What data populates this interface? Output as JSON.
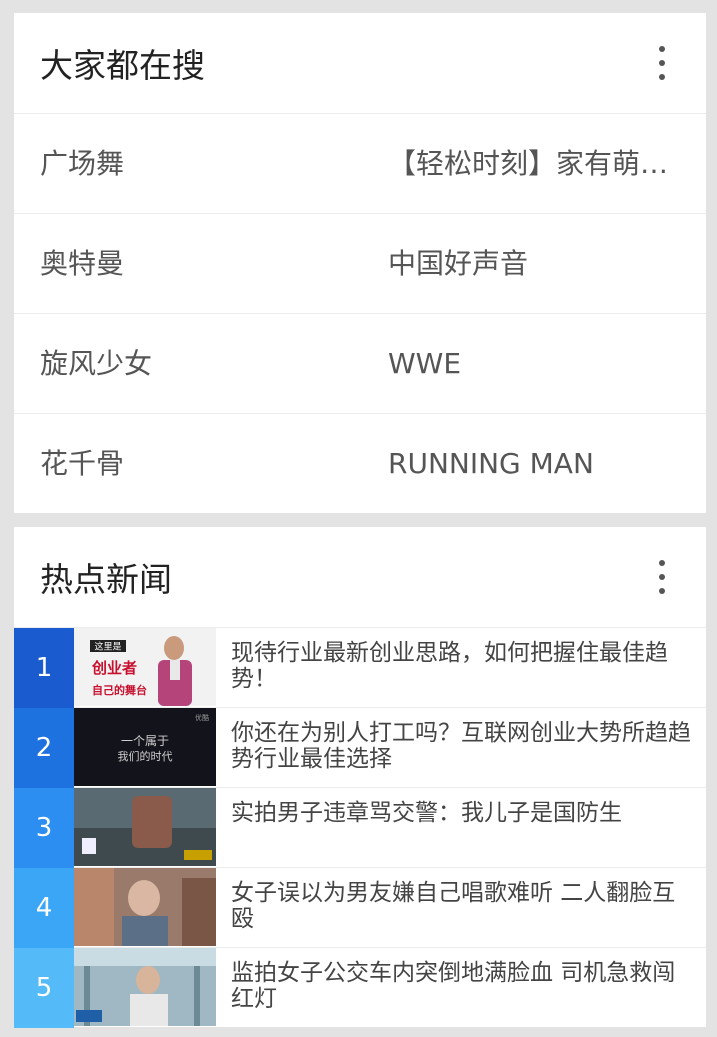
{
  "search_card": {
    "title": "大家都在搜",
    "rows": [
      {
        "left": "广场舞",
        "right": "【轻松时刻】家有萌…"
      },
      {
        "left": "奥特曼",
        "right": "中国好声音"
      },
      {
        "left": "旋风少女",
        "right": "WWE"
      },
      {
        "left": "花千骨",
        "right": "RUNNING MAN"
      }
    ]
  },
  "news_card": {
    "title": "热点新闻",
    "items": [
      {
        "rank": "1",
        "title": "现待行业最新创业思路，如何把握住最佳趋势！",
        "rank_color": "#1a5bd0",
        "thumb_overlay_1": "这里是",
        "thumb_overlay_2": "创业者",
        "thumb_overlay_3": "自己的舞台"
      },
      {
        "rank": "2",
        "title": "你还在为别人打工吗？互联网创业大势所趋趋势行业最佳选择",
        "rank_color": "#1e72e0",
        "thumb_overlay_1": "一个属于",
        "thumb_overlay_2": "我们的时代",
        "thumb_overlay_3": "优酷"
      },
      {
        "rank": "3",
        "title": "实拍男子违章骂交警：我儿子是国防生",
        "rank_color": "#2b8ef0",
        "thumb_overlay_1": "",
        "thumb_overlay_2": "",
        "thumb_overlay_3": ""
      },
      {
        "rank": "4",
        "title": "女子误以为男友嫌自己唱歌难听 二人翻脸互殴",
        "rank_color": "#3aa6f5",
        "thumb_overlay_1": "",
        "thumb_overlay_2": "",
        "thumb_overlay_3": ""
      },
      {
        "rank": "5",
        "title": "监拍女子公交车内突倒地满脸血 司机急救闯红灯",
        "rank_color": "#54baf8",
        "thumb_overlay_1": "",
        "thumb_overlay_2": "",
        "thumb_overlay_3": ""
      }
    ]
  },
  "icons": {
    "more": "more-vertical-icon"
  }
}
